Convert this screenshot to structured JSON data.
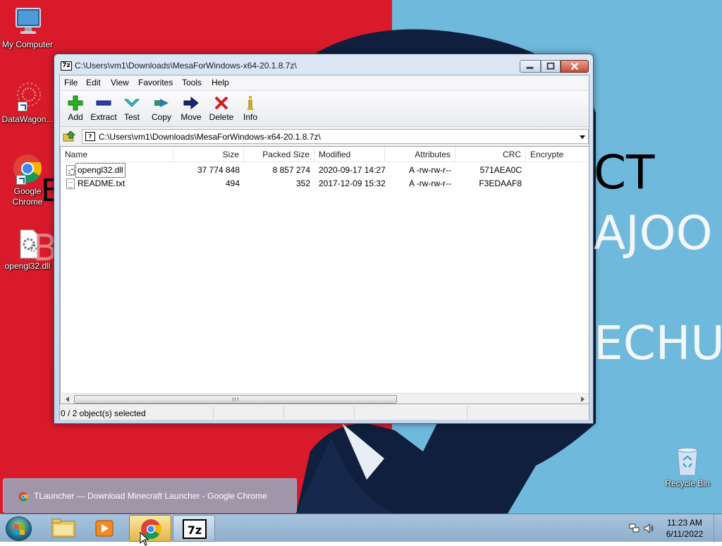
{
  "desktop": {
    "icons": [
      {
        "label": "My Computer",
        "icon": "computer-icon"
      },
      {
        "label": "DataWagon...",
        "icon": "datawagon-icon"
      },
      {
        "label": "Google Chrome",
        "icon": "chrome-icon"
      },
      {
        "label": "opengl32.dll",
        "icon": "dll-file-icon"
      },
      {
        "label": "Recycle Bin",
        "icon": "recycle-bin-icon"
      }
    ],
    "wallpaper": {
      "text_lines": [
        "CT",
        "AJOO",
        "ECHUD",
        "E",
        "B"
      ],
      "colors": {
        "left": "#d91a2a",
        "right": "#6fb9dd",
        "figure": "#0f1f3d"
      }
    }
  },
  "window": {
    "title": "C:\\Users\\vm1\\Downloads\\MesaForWindows-x64-20.1.8.7z\\",
    "app_icon_text": "7z",
    "menu": [
      "File",
      "Edit",
      "View",
      "Favorites",
      "Tools",
      "Help"
    ],
    "toolbar": [
      {
        "label": "Add",
        "icon": "plus-icon"
      },
      {
        "label": "Extract",
        "icon": "minus-icon"
      },
      {
        "label": "Test",
        "icon": "check-icon"
      },
      {
        "label": "Copy",
        "icon": "copy-arrow-icon"
      },
      {
        "label": "Move",
        "icon": "move-arrow-icon"
      },
      {
        "label": "Delete",
        "icon": "delete-x-icon"
      },
      {
        "label": "Info",
        "icon": "info-icon"
      }
    ],
    "address": "C:\\Users\\vm1\\Downloads\\MesaForWindows-x64-20.1.8.7z\\",
    "columns": [
      "Name",
      "Size",
      "Packed Size",
      "Modified",
      "Attributes",
      "CRC",
      "Encrypte"
    ],
    "files": [
      {
        "name": "opengl32.dll",
        "size": "37 774 848",
        "packed": "8 857 274",
        "modified": "2020-09-17 14:27",
        "attributes": "A -rw-rw-r--",
        "crc": "571AEA0C",
        "type": "dll"
      },
      {
        "name": "README.txt",
        "size": "494",
        "packed": "352",
        "modified": "2017-12-09 15:32",
        "attributes": "A -rw-rw-r--",
        "crc": "F3EDAAF8",
        "type": "txt"
      }
    ],
    "status": "0 / 2 object(s) selected"
  },
  "preview": {
    "title": "TLauncher — Download Minecraft Launcher - Google Chrome"
  },
  "taskbar": {
    "buttons": [
      "Windows Explorer",
      "Windows Media Player",
      "Google Chrome",
      "7-Zip"
    ],
    "sevenzip_text": "7z",
    "clock": {
      "time": "11:23 AM",
      "date": "6/11/2022"
    }
  }
}
